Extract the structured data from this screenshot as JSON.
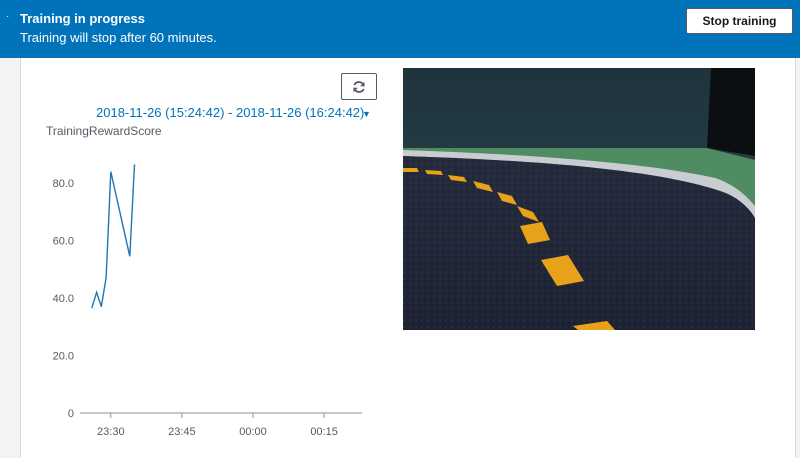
{
  "banner": {
    "title": "Training in progress",
    "subtitle": "Training will stop after 60 minutes.",
    "stop_button_label": "Stop training",
    "bg_color": "#0073bb"
  },
  "chart_controls": {
    "refresh_icon": "refresh-icon",
    "date_range": "2018-11-26 (15:24:42) - 2018-11-26 (16:24:42)",
    "caret_icon": "caret-down-icon"
  },
  "chart_data": {
    "type": "line",
    "ylabel": "TrainingRewardScore",
    "y_ticks": [
      "0",
      "20.0",
      "40.0",
      "60.0",
      "80.0"
    ],
    "x_ticks": [
      "23:30",
      "23:45",
      "00:00",
      "00:15"
    ],
    "ylim": [
      0,
      95
    ],
    "grid": false,
    "series": [
      {
        "color": "#1f77b4",
        "points": [
          [
            "23:26",
            36.5
          ],
          [
            "23:27",
            42
          ],
          [
            "23:28",
            37
          ],
          [
            "23:29",
            47
          ],
          [
            "23:30",
            84
          ],
          [
            "23:34",
            54.5
          ],
          [
            "23:35",
            86.5
          ]
        ]
      }
    ]
  },
  "video": {
    "icon": "track-camera-view"
  }
}
